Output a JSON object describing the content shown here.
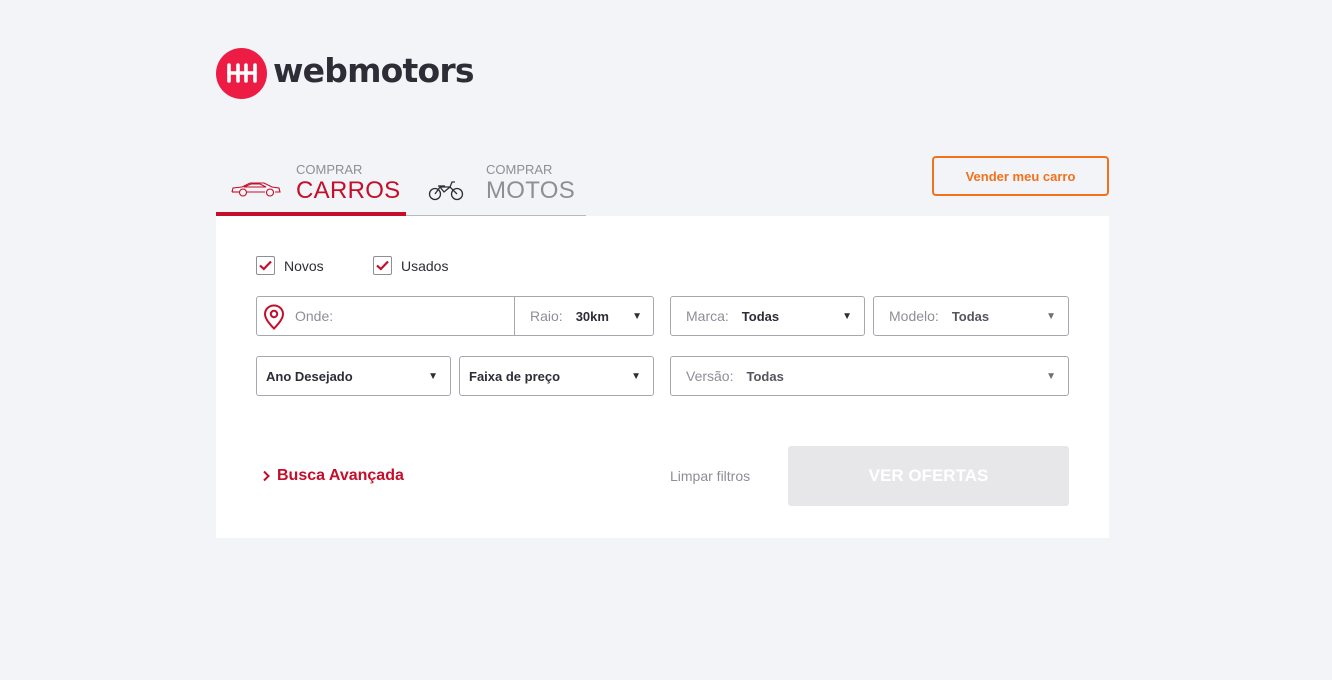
{
  "brand": {
    "name": "webmotors",
    "color": "#ed1c44"
  },
  "tabs": [
    {
      "small": "COMPRAR",
      "label": "CARROS",
      "icon": "car-icon",
      "active": true
    },
    {
      "small": "COMPRAR",
      "label": "MOTOS",
      "icon": "motorcycle-icon",
      "active": false
    }
  ],
  "sell_button": "Vender meu carro",
  "filters": {
    "checkboxes": [
      {
        "label": "Novos",
        "checked": true
      },
      {
        "label": "Usados",
        "checked": true
      }
    ],
    "location": {
      "placeholder": "Onde:",
      "icon": "location-pin-icon"
    },
    "radius": {
      "label": "Raio:",
      "value": "30km"
    },
    "brand": {
      "label": "Marca:",
      "value": "Todas"
    },
    "model": {
      "label": "Modelo:",
      "value": "Todas"
    },
    "year": {
      "value": "Ano Desejado"
    },
    "price": {
      "value": "Faixa de preço"
    },
    "version": {
      "label": "Versão:",
      "value": "Todas"
    }
  },
  "advanced_search": "Busca Avançada",
  "clear_filters": "Limpar filtros",
  "see_offers": "VER OFERTAS",
  "colors": {
    "accent": "#c40e2a",
    "orange": "#f2711c",
    "background": "#f3f4f8"
  }
}
